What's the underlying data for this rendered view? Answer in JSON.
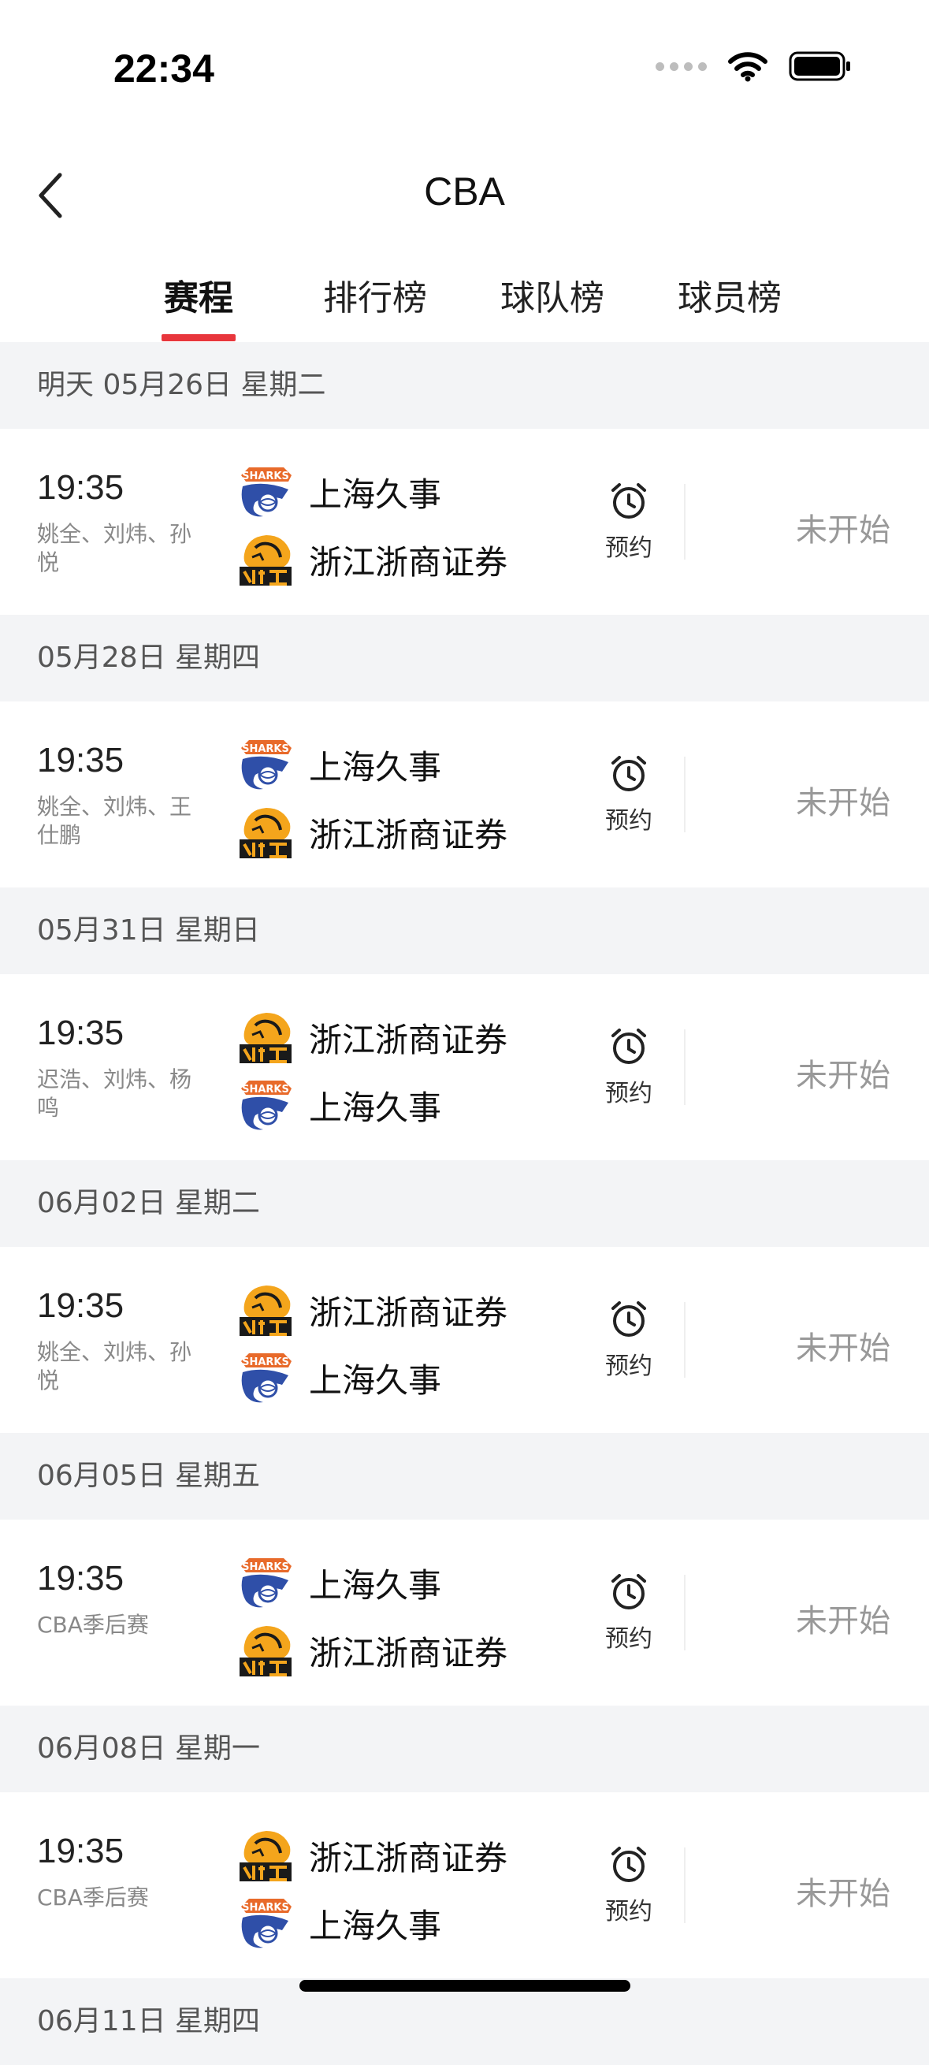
{
  "status_bar": {
    "time": "22:34"
  },
  "nav": {
    "title": "CBA"
  },
  "tabs": [
    {
      "label": "赛程",
      "active": true
    },
    {
      "label": "排行榜",
      "active": false
    },
    {
      "label": "球队榜",
      "active": false
    },
    {
      "label": "球员榜",
      "active": false
    }
  ],
  "colors": {
    "accent": "#e8363c",
    "section_bg": "#f3f4f6",
    "shanghai_blue": "#2f4fa8",
    "zhejiang_gold": "#f4a51c"
  },
  "reserve_label": "预约",
  "status_label": "未开始",
  "schedule": [
    {
      "date": "明天 05月26日 星期二",
      "time": "19:35",
      "note": "姚全、刘炜、孙悦",
      "team1": {
        "name": "上海久事",
        "logo": "shanghai"
      },
      "team2": {
        "name": "浙江浙商证券",
        "logo": "zhejiang"
      }
    },
    {
      "date": "05月28日 星期四",
      "time": "19:35",
      "note": "姚全、刘炜、王仕鹏",
      "team1": {
        "name": "上海久事",
        "logo": "shanghai"
      },
      "team2": {
        "name": "浙江浙商证券",
        "logo": "zhejiang"
      }
    },
    {
      "date": "05月31日 星期日",
      "time": "19:35",
      "note": "迟浩、刘炜、杨鸣",
      "team1": {
        "name": "浙江浙商证券",
        "logo": "zhejiang"
      },
      "team2": {
        "name": "上海久事",
        "logo": "shanghai"
      }
    },
    {
      "date": "06月02日 星期二",
      "time": "19:35",
      "note": "姚全、刘炜、孙悦",
      "team1": {
        "name": "浙江浙商证券",
        "logo": "zhejiang"
      },
      "team2": {
        "name": "上海久事",
        "logo": "shanghai"
      }
    },
    {
      "date": "06月05日 星期五",
      "time": "19:35",
      "note": "CBA季后赛",
      "team1": {
        "name": "上海久事",
        "logo": "shanghai"
      },
      "team2": {
        "name": "浙江浙商证券",
        "logo": "zhejiang"
      }
    },
    {
      "date": "06月08日 星期一",
      "time": "19:35",
      "note": "CBA季后赛",
      "team1": {
        "name": "浙江浙商证券",
        "logo": "zhejiang"
      },
      "team2": {
        "name": "上海久事",
        "logo": "shanghai"
      }
    },
    {
      "date": "06月11日 星期四"
    }
  ]
}
